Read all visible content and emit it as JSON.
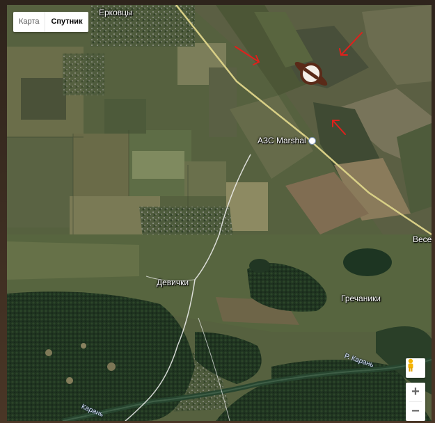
{
  "map_type": {
    "map_label": "Карта",
    "satellite_label": "Спутник",
    "active": "satellite"
  },
  "controls": {
    "zoom_in": "+",
    "zoom_out": "−",
    "pegman_icon": "pegman-icon"
  },
  "places": {
    "erkovtsy": "Ерковцы",
    "azs": "АЗС Marshal",
    "devichki": "Девички",
    "grechaniki": "Гречаники",
    "vese": "Весе",
    "karan_river_east": "Р. Карань",
    "karan_river_west": "Карань"
  },
  "annotations": {
    "arrow_color": "#e0201c",
    "marker_color": "#5a2a18"
  }
}
